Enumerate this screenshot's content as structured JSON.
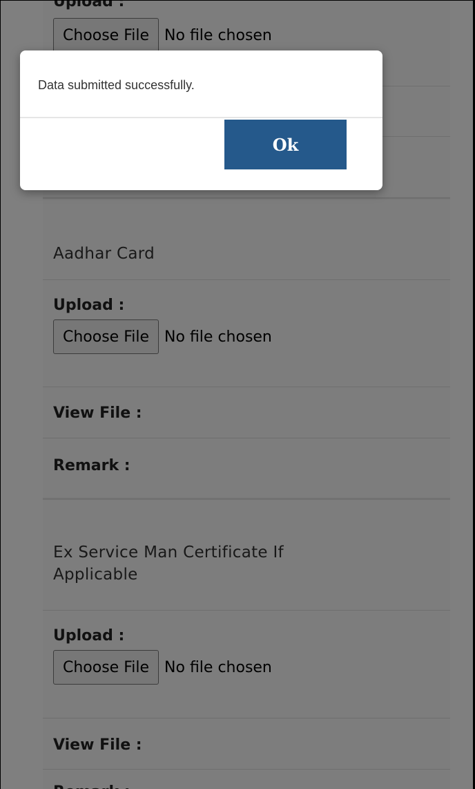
{
  "top_section": {
    "upload_label": "Upload :",
    "choose_file_label": "Choose File",
    "no_file_text": "No file chosen"
  },
  "aadhar_section": {
    "title": "Aadhar Card",
    "upload_label": "Upload :",
    "choose_file_label": "Choose File",
    "no_file_text": "No file chosen",
    "view_file_label": "View File :",
    "remark_label": "Remark :"
  },
  "ex_service_section": {
    "title_line1": "Ex Service Man Certificate If",
    "title_line2": "Applicable",
    "upload_label": "Upload :",
    "choose_file_label": "Choose File",
    "no_file_text": "No file chosen",
    "view_file_label": "View File :",
    "remark_label": "Remark :"
  },
  "dialog": {
    "message": "Data submitted successfully.",
    "ok_label": "Ok"
  },
  "colors": {
    "overlay": "rgba(0,0,0,0.5)",
    "ok_button_bg": "#25598b",
    "ok_button_text": "#ffffff"
  }
}
